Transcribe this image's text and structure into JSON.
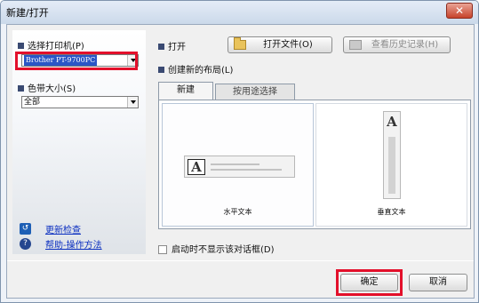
{
  "window": {
    "title": "新建/打开",
    "close_label": "✕"
  },
  "printer": {
    "label": "选择打印机(P)",
    "selected": "Brother PT-9700PC"
  },
  "tape_size": {
    "label": "色带大小(S)",
    "selected": "全部"
  },
  "links": {
    "update_check": "更新检查",
    "help": "帮助-操作方法",
    "update_icon": "update-icon",
    "help_icon": "help-icon"
  },
  "open": {
    "label": "打开",
    "open_file_button": "打开文件(O)",
    "history_button": "查看历史记录(H)"
  },
  "new_layout": {
    "label": "创建新的布局(L)",
    "tabs": [
      {
        "label": "新建",
        "active": true
      },
      {
        "label": "按用途选择",
        "active": false
      }
    ],
    "options": [
      {
        "label": "水平文本",
        "icon": "horizontal-tape-icon",
        "glyph": "A"
      },
      {
        "label": "垂直文本",
        "icon": "vertical-tape-icon",
        "glyph": "A"
      }
    ]
  },
  "startup_checkbox": {
    "label": "启动时不显示该对话框(D)",
    "checked": false
  },
  "footer": {
    "ok": "确定",
    "cancel": "取消"
  },
  "colors": {
    "highlight": "#e3102b",
    "selection": "#2a56c6",
    "link": "#0b2fc0"
  }
}
